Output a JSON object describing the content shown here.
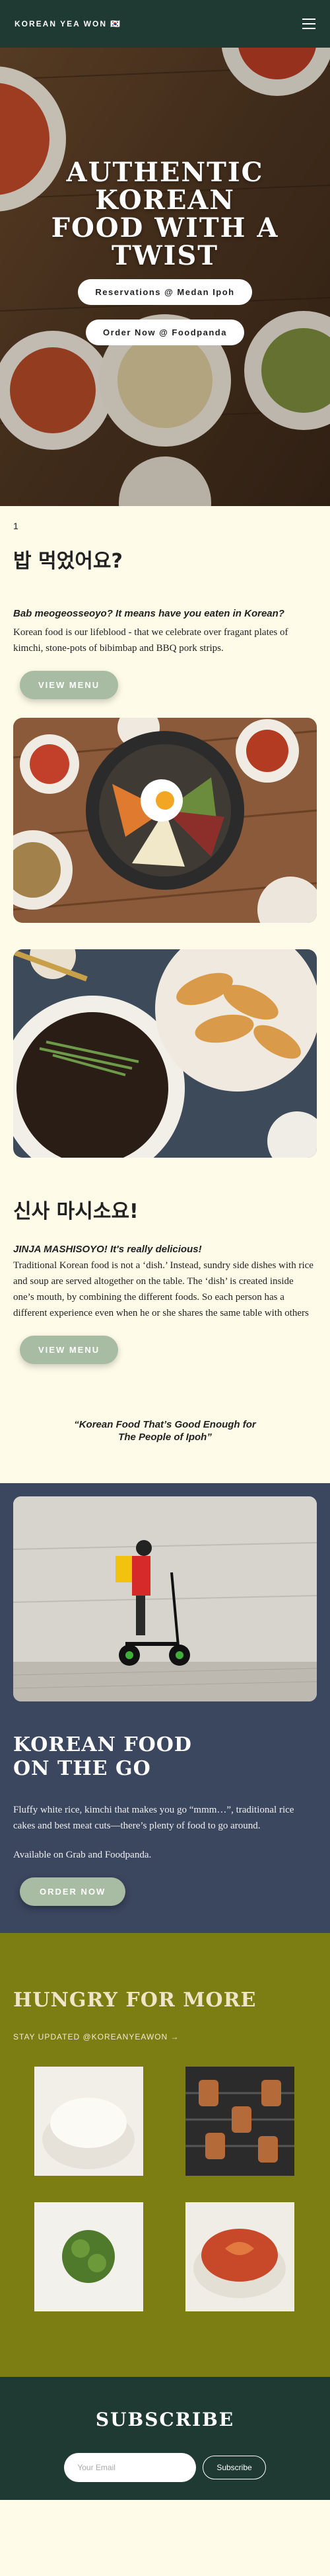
{
  "header": {
    "brand": "KOREAN YEA WON 🇰🇷",
    "menu_icon": "hamburger-icon"
  },
  "hero": {
    "title": "AUTHENTIC KOREAN FOOD WITH A TWIST",
    "reservations_label": "Reservations @ Medan Ipoh",
    "order_label": "Order Now @ Foodpanda"
  },
  "intro": {
    "page_number": "1",
    "title_ko": "밥 먹었어요?",
    "subhead": "Bab meogeosseoyo? It means have you eaten in Korean?",
    "body": "Korean food is our lifeblood - that we celebrate over fragant plates of kimchi, stone-pots of bibimbap and BBQ pork strips.",
    "button": "VIEW MENU"
  },
  "second": {
    "title_ko": "신사 마시소요!",
    "subhead": "JINJA MASHISOYO! It's really delicious!",
    "body": "Traditional Korean food is not a ‘dish.’ Instead, sundry side dishes with rice and soup are served altogether on the table. The ‘dish’ is created inside one’s mouth, by combining the different foods. So each person has a different experience even when he or she shares the same table with others",
    "button": "VIEW MENU"
  },
  "quote": {
    "line1": "“Korean Food That’s Good Enough for",
    "line2": "The People of Ipoh”"
  },
  "go": {
    "title": "KOREAN FOOD ON THE GO",
    "body": "Fluffy white rice, kimchi that makes you go “mmm…”, traditional rice cakes and best meat cuts—there’s plenty of food to go around.",
    "body2": "Available on Grab and Foodpanda.",
    "button": "ORDER NOW"
  },
  "hungry": {
    "title": "HUNGRY FOR MORE",
    "handle": "STAY UPDATED @KOREANYEAWON →"
  },
  "footer": {
    "title": "SUBSCRIBE",
    "email_placeholder": "Your Email",
    "subscribe_label": "Subscribe"
  },
  "colors": {
    "header_bg": "#1f3a32",
    "cream": "#fefbe9",
    "blue": "#3b465f",
    "olive": "#7c7d13",
    "button_green": "#a8bca3"
  }
}
